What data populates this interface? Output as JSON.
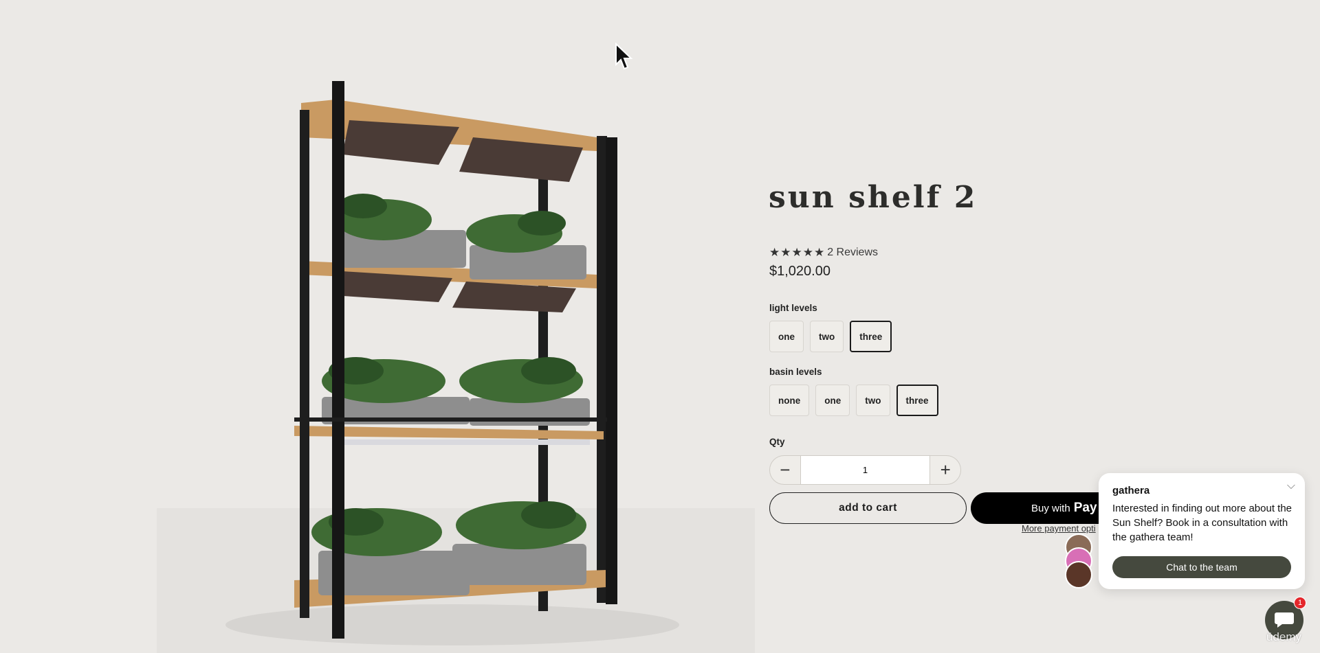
{
  "product": {
    "title": "sun shelf 2",
    "stars": "★★★★★",
    "reviews": "2 Reviews",
    "price": "$1,020.00",
    "image_alt": "sun shelf with four wooden shelves, grow lights and planter basins"
  },
  "light_levels": {
    "label": "light levels",
    "options": [
      "one",
      "two",
      "three"
    ],
    "selected": "three"
  },
  "basin_levels": {
    "label": "basin levels",
    "options": [
      "none",
      "one",
      "two",
      "three"
    ],
    "selected": "three"
  },
  "quantity": {
    "label": "Qty",
    "value": "1",
    "minus": "−",
    "plus": "+"
  },
  "actions": {
    "add_to_cart": "add to cart",
    "buy_with": "Buy with",
    "buy_with_pay": " Pay",
    "more_payment": "More payment opti"
  },
  "chat": {
    "brand": "gathera",
    "message": "Interested in finding out more about the Sun Shelf? Book in a consultation with the gathera team!",
    "button": "Chat to the team",
    "badge_count": "1",
    "close": "⌵"
  },
  "watermark": "ūdemy",
  "colors": {
    "background": "#ebe9e6",
    "chat_button": "#45493e",
    "badge": "#e4262b"
  }
}
